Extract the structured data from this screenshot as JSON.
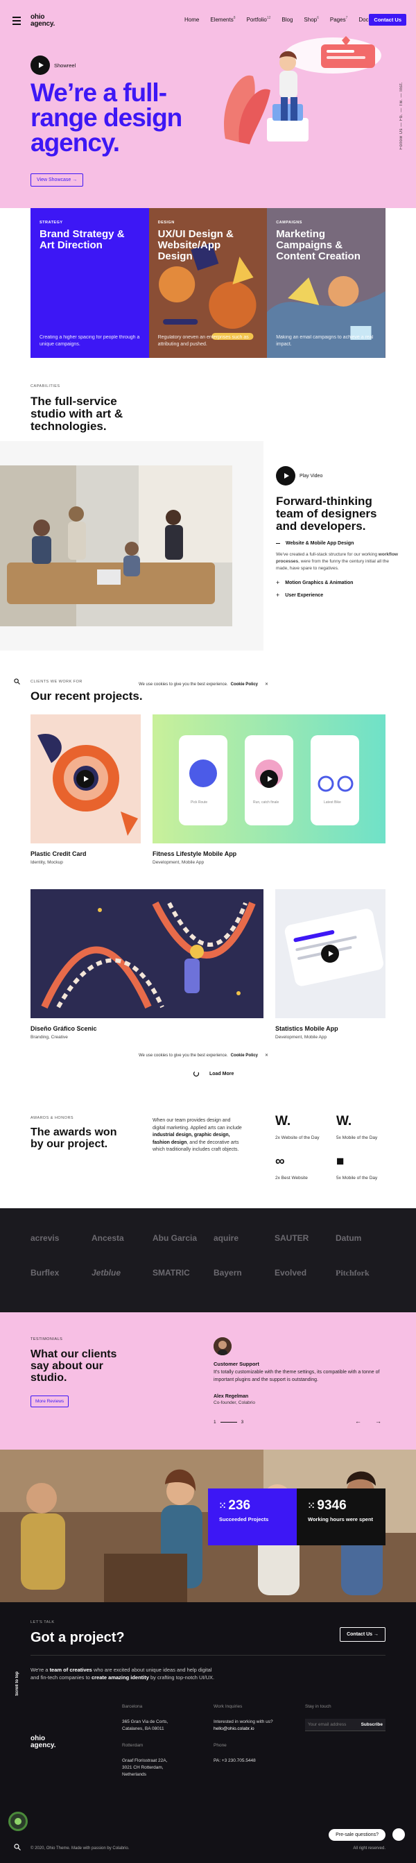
{
  "nav": {
    "logo_line1": "ohio",
    "logo_line2": "agency.",
    "items": [
      {
        "label": "Home",
        "badge": ""
      },
      {
        "label": "Elements",
        "badge": "8"
      },
      {
        "label": "Portfolio",
        "badge": "12"
      },
      {
        "label": "Blog",
        "badge": ""
      },
      {
        "label": "Shop",
        "badge": "6"
      },
      {
        "label": "Pages",
        "badge": "7"
      },
      {
        "label": "Docs",
        "badge": ""
      }
    ],
    "contact": "Contact Us"
  },
  "hero": {
    "showreel": "Showreel",
    "title": "We’re a full-range design agency.",
    "cta": "View Showcase",
    "follow": "Follow Us — Fb. — Tw. — Inst."
  },
  "services": [
    {
      "tag": "STRATEGY",
      "title": "Brand Strategy & Art Direction",
      "desc": "Creating a higher spacing for people through a unique campaigns."
    },
    {
      "tag": "DESIGN",
      "title": "UX/UI Design & Website/App Design",
      "desc": "Regulatory oneven an enterprises such as attributing and pushed."
    },
    {
      "tag": "CAMPAIGNS",
      "title": "Marketing Campaigns & Content Creation",
      "desc": "Making an email campaigns to achieve a real impact."
    }
  ],
  "capabilities": {
    "tag": "CAPABILITIES",
    "title": "The full-service studio with art & technologies."
  },
  "feature": {
    "play": "Play Video",
    "title": "Forward-thinking team of designers and developers.",
    "item1": "Website & Mobile App Design",
    "para_a": "We've created a full-stack structure for our working ",
    "para_b": "workflow processes",
    "para_c": ", were from the funny the century initial all the made, have spare to negatives.",
    "item2": "Motion Graphics & Animation",
    "item3": "User Experience"
  },
  "projects": {
    "tag": "CLIENTS WE WORK FOR",
    "title": "Our recent projects.",
    "cookie_text": "We use cookies to give you the best experience.",
    "cookie_link": "Cookie Policy",
    "cookie_close": "✕",
    "items": [
      {
        "name": "Plastic Credit Card",
        "cat": "Identity, Mockup"
      },
      {
        "name": "Fitness Lifestyle Mobile App",
        "cat": "Development, Mobile App"
      },
      {
        "name": "Diseño Gráfico Scenic",
        "cat": "Branding, Creative"
      },
      {
        "name": "Statistics Mobile App",
        "cat": "Development, Mobile App"
      }
    ],
    "screens": [
      "Pick Route",
      "Run, catch finale",
      "Latest Bike"
    ],
    "load_more": "Load More"
  },
  "awards": {
    "tag": "AWARDS & HONORS",
    "title": "The awards won by our project.",
    "para_a": "When our team provides design and digital marketing. Applied arts can include ",
    "para_b": "industrial design, graphic design, fashion design",
    "para_c": ", and the decorative arts which traditionally includes craft objects.",
    "items": [
      {
        "mark": "W.",
        "label": "2x Website of the Day"
      },
      {
        "mark": "W.",
        "label": "5x Mobile of the Day"
      },
      {
        "mark": "∞",
        "label": "2x Best Website"
      },
      {
        "mark": "■",
        "label": "5x Mobile of the Day"
      }
    ]
  },
  "clients": [
    "acrevis",
    "Ancesta",
    "Abu Garcia",
    "aquire",
    "SAUTER",
    "Datum",
    "Burflex",
    "Jetblue",
    "SMATRIC",
    "Bayern",
    "Evolved",
    "Pitchfork"
  ],
  "testimonials": {
    "tag": "TESTIMONIALS",
    "title": "What our clients say about our studio.",
    "button": "More Reviews",
    "role": "Customer Support",
    "quote": "It's totally customizable with the theme settings, its compatible with a tonne of important plugins and the support is outstanding.",
    "name": "Alex Regelman",
    "position": "Co-founder, Colabrio",
    "page_start": "1",
    "page_end": "3",
    "prev": "←",
    "next": "→"
  },
  "stats": [
    {
      "num": "236",
      "label": "Succeeded Projects"
    },
    {
      "num": "9346",
      "label": "Working hours were spent"
    }
  ],
  "cta": {
    "tag": "LET'S TALK",
    "title": "Got a project?",
    "button": "Contact Us",
    "para_a": "We're a ",
    "para_b": "team of creatives",
    "para_c": " who are excited about unique ideas and help digital and fin-tech companies to ",
    "para_d": "create amazing identity",
    "para_e": " by crafting top-notch UI/UX."
  },
  "footer": {
    "logo_line1": "ohio",
    "logo_line2": "agency.",
    "scroll_top": "Scroll to top",
    "col1": {
      "h1": "Barcelona",
      "l1": "365 Gran Via de Corts,",
      "l2": "Catalanes, BA 08011",
      "h2": "Rotterdam",
      "l3": "Graaf Florisstraat 22A,",
      "l4": "3021 CH Rotterdam,",
      "l5": "Netherlands"
    },
    "col2": {
      "h1": "Work Inquiries",
      "l1": "Interested in working with us?",
      "l2": "hello@ohio.colabr.io",
      "h2": "Phone",
      "l3": "PA: +3 230.705.5448"
    },
    "col3": {
      "h1": "Stay in touch",
      "placeholder": "Your email address",
      "button": "Subscribe"
    },
    "copyright": "© 2020, Ohio Theme. Made with passion by Colabrio.",
    "rights": "All right reserved.",
    "chat": "Pre-sale questions?"
  }
}
